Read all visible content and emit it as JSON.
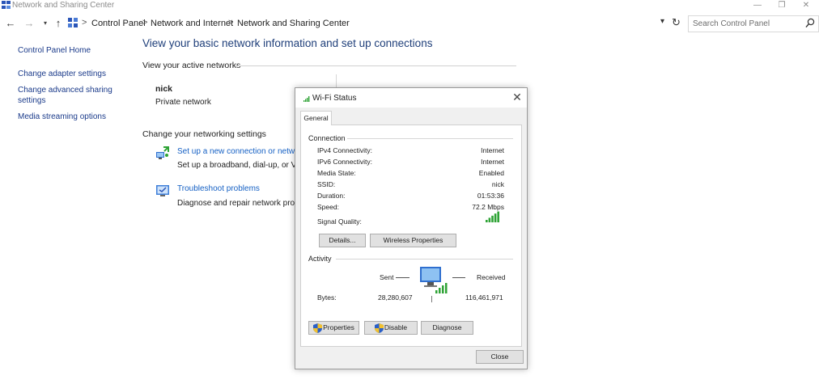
{
  "window": {
    "title": "Network and Sharing Center",
    "min_glyph": "—",
    "max_glyph": "❐",
    "close_glyph": "✕"
  },
  "nav": {
    "back": "←",
    "forward": "→",
    "recent": "▾",
    "up": "↑",
    "breadcrumb": [
      "Control Panel",
      "Network and Internet",
      "Network and Sharing Center"
    ],
    "separator": ">",
    "dropdown": "▾",
    "refresh": "↻"
  },
  "search": {
    "placeholder": "Search Control Panel"
  },
  "sidebar": {
    "items": [
      {
        "label": "Control Panel Home"
      },
      {
        "label": "Change adapter settings"
      },
      {
        "label": "Change advanced sharing settings"
      },
      {
        "label": "Media streaming options"
      }
    ]
  },
  "main": {
    "title": "View your basic network information and set up connections",
    "active_networks_label": "View your active networks",
    "network": {
      "name": "nick",
      "type": "Private network"
    },
    "change_settings_label": "Change your networking settings",
    "tasks": [
      {
        "link": "Set up a new connection or network",
        "desc": "Set up a broadband, dial-up, or VPN connection; or set up a router or access point."
      },
      {
        "link": "Troubleshoot problems",
        "desc": "Diagnose and repair network problems, or get troubleshooting information."
      }
    ]
  },
  "dialog": {
    "title": "Wi-Fi Status",
    "close_glyph": "✕",
    "tab": "General",
    "connection_label": "Connection",
    "fields": [
      {
        "label": "IPv4 Connectivity:",
        "value": "Internet"
      },
      {
        "label": "IPv6 Connectivity:",
        "value": "Internet"
      },
      {
        "label": "Media State:",
        "value": "Enabled"
      },
      {
        "label": "SSID:",
        "value": "nick"
      },
      {
        "label": "Duration:",
        "value": "01:53:36"
      },
      {
        "label": "Speed:",
        "value": "72.2 Mbps"
      }
    ],
    "signal_label": "Signal Quality:",
    "signal_bars": 5,
    "details_button": "Details...",
    "wireless_props_button": "Wireless Properties",
    "activity_label": "Activity",
    "sent_label": "Sent",
    "received_label": "Received",
    "bytes_label": "Bytes:",
    "bytes_sent": "28,280,607",
    "bytes_received": "116,461,971",
    "properties_button": "Properties",
    "disable_button": "Disable",
    "diagnose_button": "Diagnose",
    "close_button": "Close"
  },
  "colors": {
    "link": "#1560c4",
    "nav_link": "#1a3a8a",
    "title": "#1f3f7a",
    "signal_green": "#2fa336"
  }
}
